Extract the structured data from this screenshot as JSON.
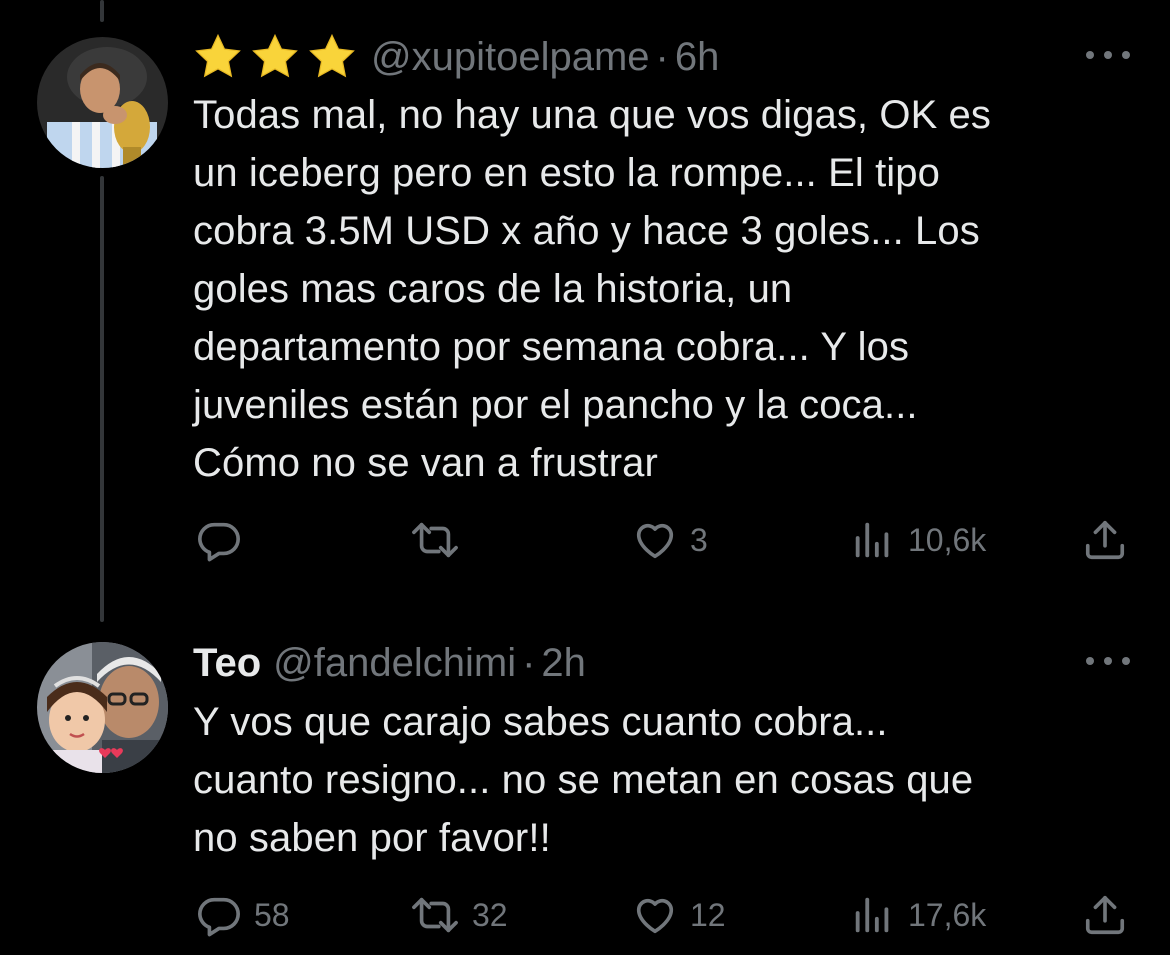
{
  "tweets": [
    {
      "display_name": "",
      "name_icons": [
        "star-icon",
        "star-icon",
        "star-icon"
      ],
      "handle": "@xupitoelpame",
      "separator": "·",
      "time": "6h",
      "text_lines": [
        "Todas mal, no hay una que vos digas, OK es",
        "un iceberg pero en esto la rompe... El tipo",
        "cobra 3.5M USD x año y hace 3 goles... Los",
        "goles mas caros de la historia, un",
        "departamento por semana cobra... Y los",
        "juveniles están por el pancho y la coca...",
        "Cómo no se van a frustrar"
      ],
      "reply_count": "",
      "retweet_count": "",
      "like_count": "3",
      "view_count": "10,6k"
    },
    {
      "display_name": "Teo",
      "handle": "@fandelchimi",
      "separator": "·",
      "time": "2h",
      "text_lines": [
        "Y vos que carajo sabes cuanto cobra...",
        "cuanto resigno... no se metan en cosas que",
        "no saben por favor!!"
      ],
      "reply_count": "58",
      "retweet_count": "32",
      "like_count": "12",
      "view_count": "17,6k"
    }
  ],
  "icons": {
    "more": "more-icon",
    "reply": "reply-icon",
    "retweet": "retweet-icon",
    "like": "heart-icon",
    "views": "views-icon",
    "share": "share-icon"
  },
  "colors": {
    "background": "#000000",
    "text_primary": "#e7e9ea",
    "text_secondary": "#71767b",
    "thread_line": "#333639",
    "star": "#f9d43a"
  }
}
